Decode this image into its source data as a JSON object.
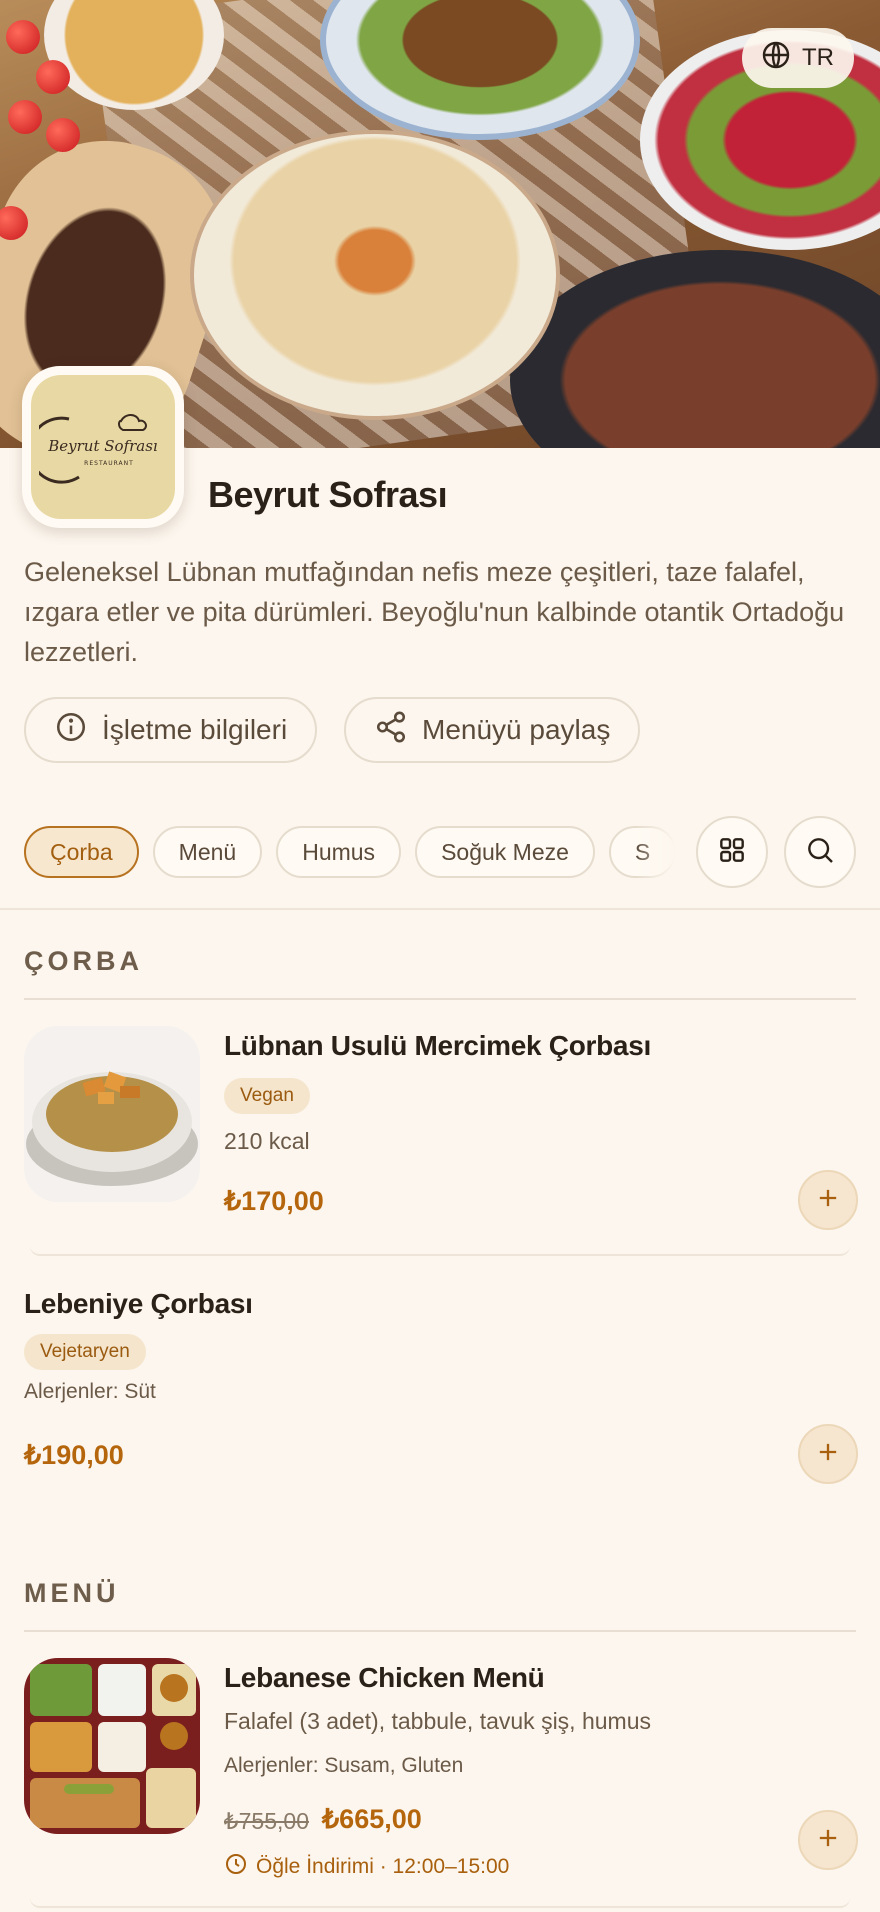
{
  "header": {
    "language": "TR",
    "restaurant_name": "Beyrut Sofrası",
    "logo_text": "Beyrut Sofrası",
    "logo_subtext": "RESTAURANT",
    "description": "Geleneksel Lübnan mutfağından nefis meze çeşitleri, taze falafel, ızgara etler ve pita dürümleri. Beyoğlu'nun kalbinde otantik Ortadoğu lezzetleri.",
    "info_button": "İşletme bilgileri",
    "share_button": "Menüyü paylaş"
  },
  "categories": [
    {
      "label": "Çorba",
      "active": true
    },
    {
      "label": "Menü",
      "active": false
    },
    {
      "label": "Humus",
      "active": false
    },
    {
      "label": "Soğuk Meze",
      "active": false
    },
    {
      "label": "S",
      "active": false
    }
  ],
  "sections": [
    {
      "title": "ÇORBA",
      "items": [
        {
          "name": "Lübnan Usulü Mercimek Çorbası",
          "tag": "Vegan",
          "calories": "210 kcal",
          "price": "₺170,00"
        },
        {
          "name": "Lebeniye Çorbası",
          "tag": "Vejetaryen",
          "allergens": "Alerjenler: Süt",
          "price": "₺190,00"
        }
      ]
    },
    {
      "title": "MENÜ",
      "items": [
        {
          "name": "Lebanese Chicken Menü",
          "description": "Falafel (3 adet), tabbule, tavuk şiş, humus",
          "allergens": "Alerjenler: Susam, Gluten",
          "old_price": "₺755,00",
          "price": "₺665,00",
          "promo": "Öğle İndirimi · 12:00–15:00"
        }
      ]
    }
  ],
  "colors": {
    "background": "#fcf6ee",
    "accent": "#b5660d",
    "tag_bg": "#f5e5cc",
    "text": "#2a2118"
  },
  "icons": {
    "language": "globe-icon",
    "info": "info-icon",
    "share": "share-icon",
    "grid": "grid-icon",
    "search": "search-icon",
    "add": "plus-icon",
    "promo": "clock-icon"
  }
}
